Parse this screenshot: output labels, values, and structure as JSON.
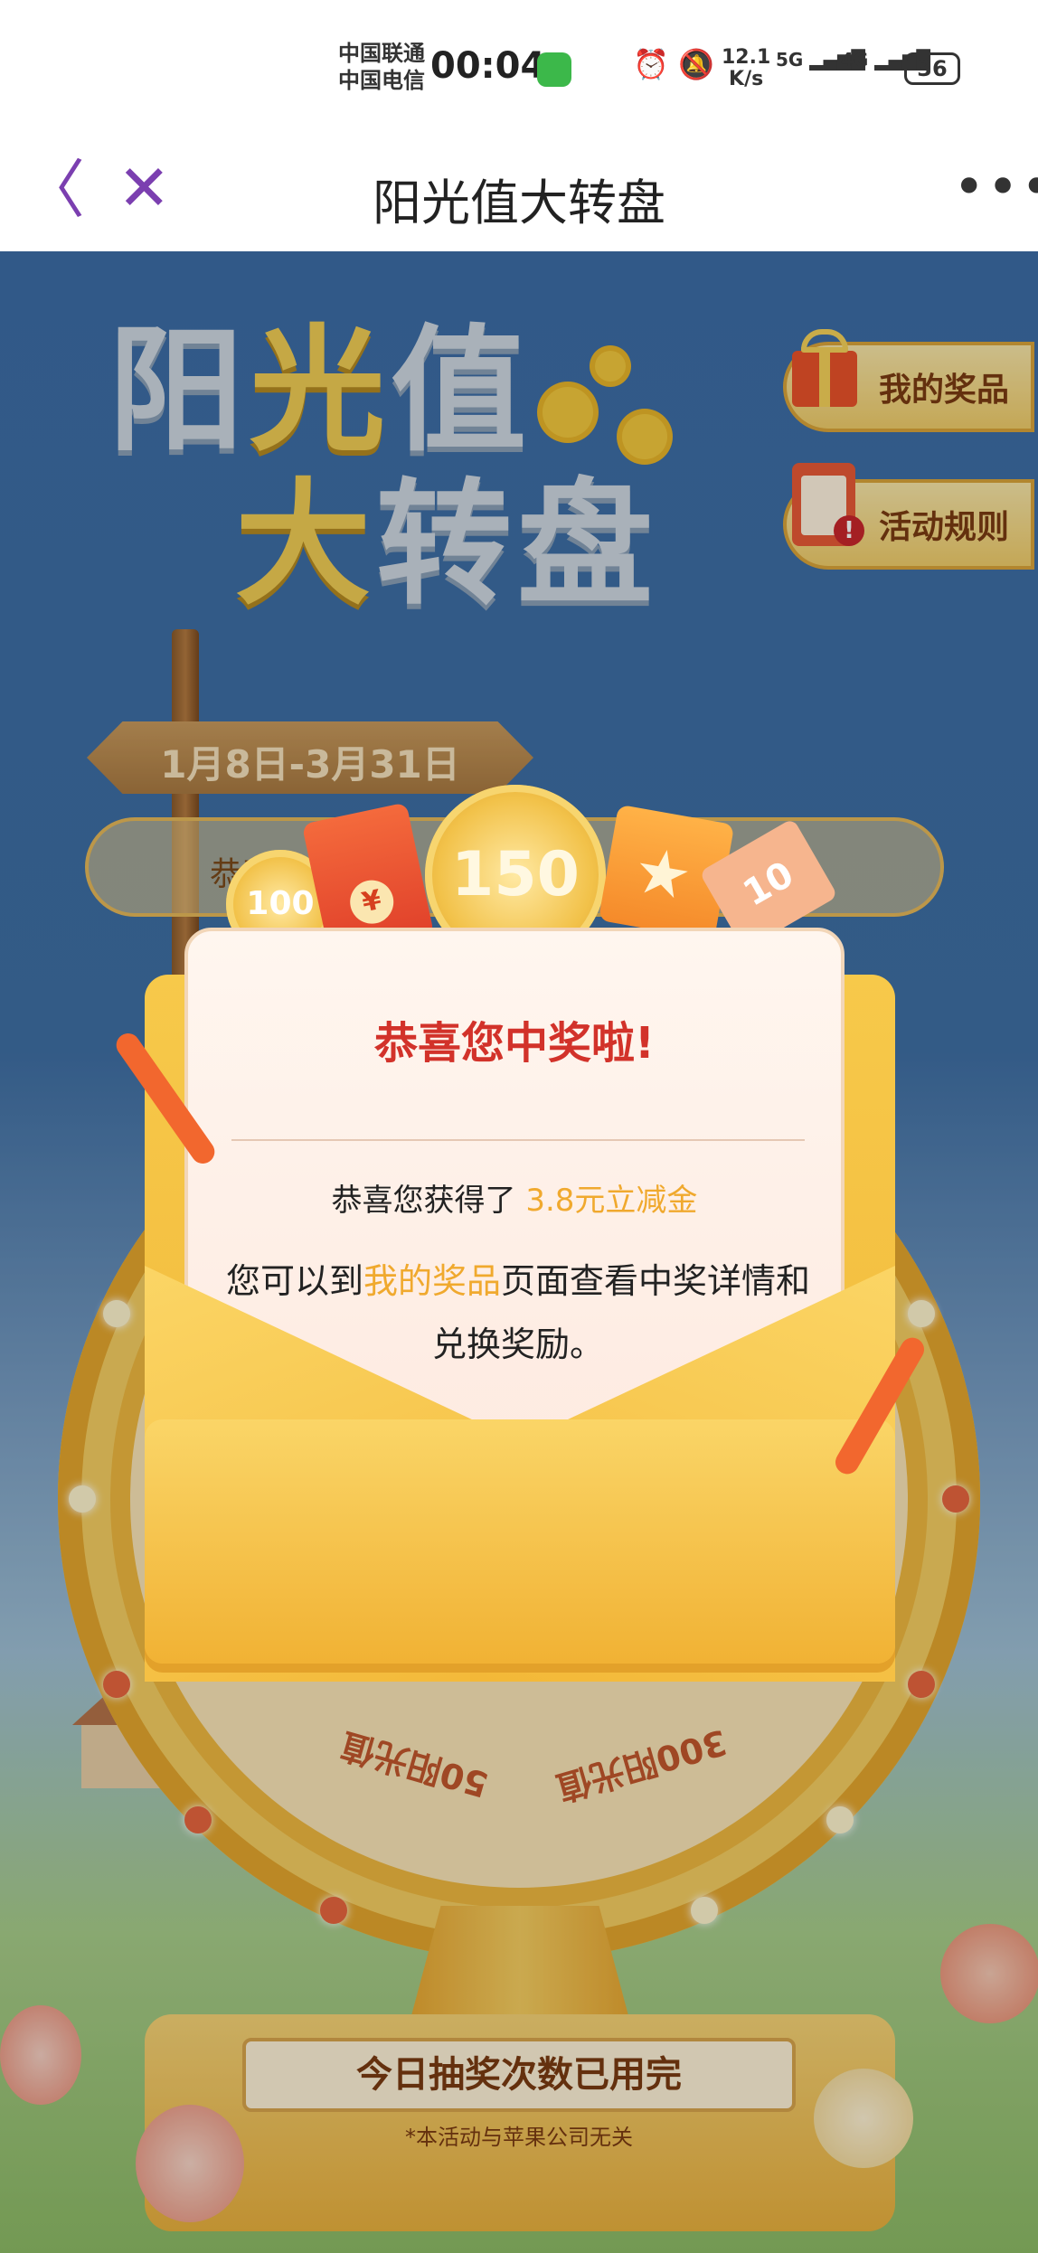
{
  "status_bar": {
    "carrier1": "中国联通",
    "carrier2": "中国电信",
    "time": "00:04",
    "net_speed_top": "12.1",
    "net_speed_bottom": "K/s",
    "signal1": "5G",
    "signal2": "4G",
    "battery": "36"
  },
  "nav": {
    "back_glyph": "〈",
    "close_glyph": "✕",
    "title": "阳光值大转盘",
    "more_glyph": "•••"
  },
  "hero": {
    "title_line1_a": "阳",
    "title_line1_b": "光",
    "title_line1_c": "值",
    "title_line2_a": "大",
    "title_line2_b": "转盘",
    "date_range": "1月8日-3月31日",
    "ticker_text": "恭喜"
  },
  "side_buttons": {
    "my_prizes": "我的奖品",
    "rules": "活动规则"
  },
  "wheel": {
    "segments": [
      "50阳光值",
      "300阳光值"
    ]
  },
  "decor": {
    "coin_small": "100",
    "coin_big": "150",
    "ticket": "10",
    "yen": "¥",
    "star": "★"
  },
  "modal": {
    "title": "恭喜您中奖啦!",
    "prize_prefix": "恭喜您获得了 ",
    "prize_value": "3.8元立减金",
    "desc_prefix": "您可以到",
    "desc_link": "我的奖品",
    "desc_suffix": "页面查看中奖详情和兑换奖励。"
  },
  "footer": {
    "draw_status": "今日抽奖次数已用完",
    "disclaimer": "*本活动与苹果公司无关"
  },
  "colors": {
    "accent_purple": "#7b3fb0",
    "prize_gold": "#f0a92e",
    "title_red": "#d2322a"
  }
}
